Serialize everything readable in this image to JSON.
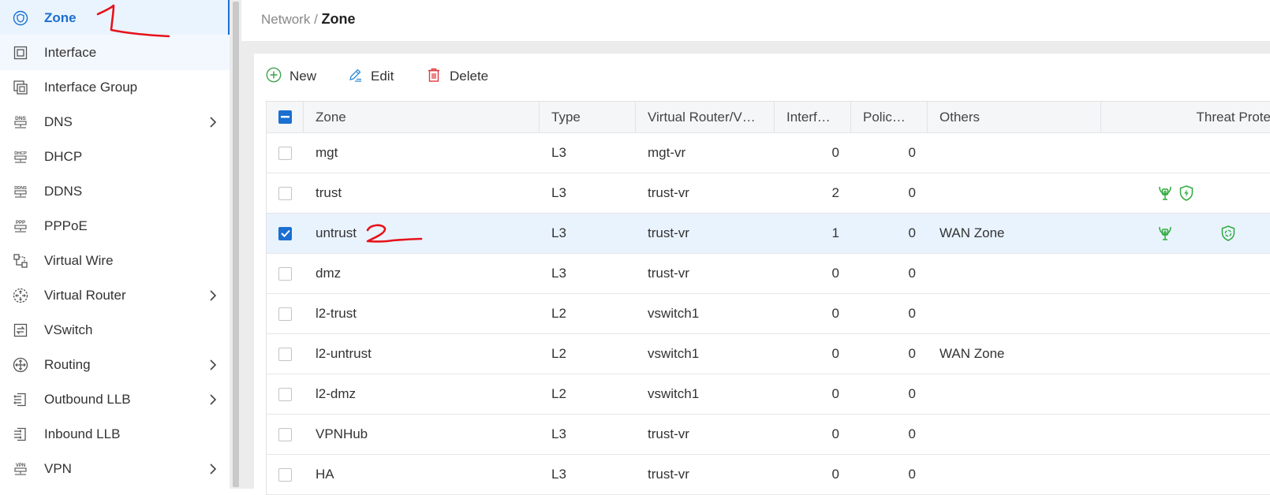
{
  "sidebar": {
    "items": [
      {
        "label": "Zone",
        "icon": "zone-shield-icon",
        "active": true
      },
      {
        "label": "Interface",
        "icon": "interface-icon",
        "hover": true
      },
      {
        "label": "Interface Group",
        "icon": "interface-group-icon"
      },
      {
        "label": "DNS",
        "icon": "dns-icon",
        "expandable": true
      },
      {
        "label": "DHCP",
        "icon": "dhcp-icon"
      },
      {
        "label": "DDNS",
        "icon": "ddns-icon"
      },
      {
        "label": "PPPoE",
        "icon": "pppoe-icon"
      },
      {
        "label": "Virtual Wire",
        "icon": "virtual-wire-icon"
      },
      {
        "label": "Virtual Router",
        "icon": "virtual-router-icon",
        "expandable": true
      },
      {
        "label": "VSwitch",
        "icon": "vswitch-icon"
      },
      {
        "label": "Routing",
        "icon": "routing-icon",
        "expandable": true
      },
      {
        "label": "Outbound LLB",
        "icon": "outbound-llb-icon",
        "expandable": true
      },
      {
        "label": "Inbound LLB",
        "icon": "inbound-llb-icon"
      },
      {
        "label": "VPN",
        "icon": "vpn-icon",
        "expandable": true
      }
    ],
    "icon_texts": {
      "dns": "DNS",
      "dhcp": "DHCP",
      "ddns": "DDNS",
      "pppoe": "PPP",
      "vpn": "VPN"
    }
  },
  "header": {
    "breadcrumb_parent": "Network",
    "breadcrumb_separator": " / ",
    "breadcrumb_current": "Zone"
  },
  "toolbar": {
    "new_label": "New",
    "edit_label": "Edit",
    "delete_label": "Delete"
  },
  "table": {
    "columns": [
      "Zone",
      "Type",
      "Virtual Router/V…",
      "Interf…",
      "Polic…",
      "Others",
      "Threat Prote"
    ],
    "rows": [
      {
        "zone": "mgt",
        "type": "L3",
        "vr": "mgt-vr",
        "interfaces": "0",
        "policies": "0",
        "others": "",
        "selected": false
      },
      {
        "zone": "trust",
        "type": "L3",
        "vr": "trust-vr",
        "interfaces": "2",
        "policies": "0",
        "others": "",
        "selected": false,
        "threat": [
          "ips-icon",
          "shield-bolt-icon"
        ]
      },
      {
        "zone": "untrust",
        "type": "L3",
        "vr": "trust-vr",
        "interfaces": "1",
        "policies": "0",
        "others": "WAN Zone",
        "selected": true,
        "threat": [
          "ips-icon",
          "shield-recycle-icon"
        ]
      },
      {
        "zone": "dmz",
        "type": "L3",
        "vr": "trust-vr",
        "interfaces": "0",
        "policies": "0",
        "others": "",
        "selected": false
      },
      {
        "zone": "l2-trust",
        "type": "L2",
        "vr": "vswitch1",
        "interfaces": "0",
        "policies": "0",
        "others": "",
        "selected": false
      },
      {
        "zone": "l2-untrust",
        "type": "L2",
        "vr": "vswitch1",
        "interfaces": "0",
        "policies": "0",
        "others": "WAN Zone",
        "selected": false
      },
      {
        "zone": "l2-dmz",
        "type": "L2",
        "vr": "vswitch1",
        "interfaces": "0",
        "policies": "0",
        "others": "",
        "selected": false
      },
      {
        "zone": "VPNHub",
        "type": "L3",
        "vr": "trust-vr",
        "interfaces": "0",
        "policies": "0",
        "others": "",
        "selected": false
      },
      {
        "zone": "HA",
        "type": "L3",
        "vr": "trust-vr",
        "interfaces": "0",
        "policies": "0",
        "others": "",
        "selected": false
      }
    ]
  },
  "colors": {
    "accent": "#1b6fd1",
    "selected_row": "#e9f3fe",
    "threat_green": "#2eaa3c",
    "new_green": "#3fa34d",
    "delete_red": "#e0393e",
    "annotation_red": "#e6121b"
  }
}
